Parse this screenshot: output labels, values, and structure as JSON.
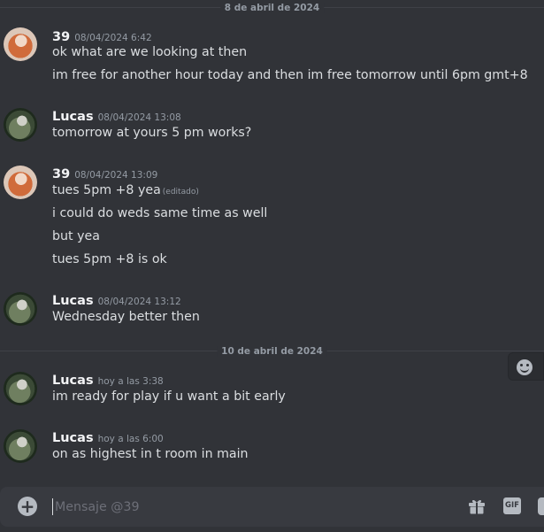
{
  "dividers": [
    "8 de abril de 2024",
    "10 de abril de 2024"
  ],
  "groups": [
    {
      "author": "39",
      "timestamp": "08/04/2024 6:42",
      "messages": [
        {
          "text": "ok what are we looking at then"
        },
        {
          "text": "im free for another hour today and then im free tomorrow until 6pm gmt+8"
        }
      ]
    },
    {
      "author": "Lucas",
      "timestamp": "08/04/2024 13:08",
      "messages": [
        {
          "text": "tomorrow at yours 5 pm works?"
        }
      ]
    },
    {
      "author": "39",
      "timestamp": "08/04/2024 13:09",
      "messages": [
        {
          "text": "tues 5pm +8 yea",
          "edited": "(editado)"
        },
        {
          "text": "i could do weds same time as well"
        },
        {
          "text": "but yea"
        },
        {
          "text": "tues 5pm +8 is ok"
        }
      ]
    },
    {
      "author": "Lucas",
      "timestamp": "08/04/2024 13:12",
      "messages": [
        {
          "text": "Wednesday better then"
        }
      ]
    },
    {
      "author": "Lucas",
      "timestamp": "hoy a las 3:38",
      "messages": [
        {
          "text": "im ready for play if u want a bit early"
        }
      ]
    },
    {
      "author": "Lucas",
      "timestamp": "hoy a las 6:00",
      "messages": [
        {
          "text": "on as highest in t room in main"
        }
      ]
    }
  ],
  "composer": {
    "placeholder": "Mensaje @39",
    "value": "",
    "gif_label": "GIF",
    "plus_label": "+"
  },
  "icons": {
    "add": "plus-circle-icon",
    "gift": "gift-icon",
    "gif": "gif-icon",
    "sticker": "sticker-icon",
    "emoji": "smiley-face-icon"
  },
  "colors": {
    "background": "#313338",
    "composer": "#383a40",
    "text": "#dbdee1",
    "muted": "#949ba4",
    "username": "#f2f3f5"
  }
}
